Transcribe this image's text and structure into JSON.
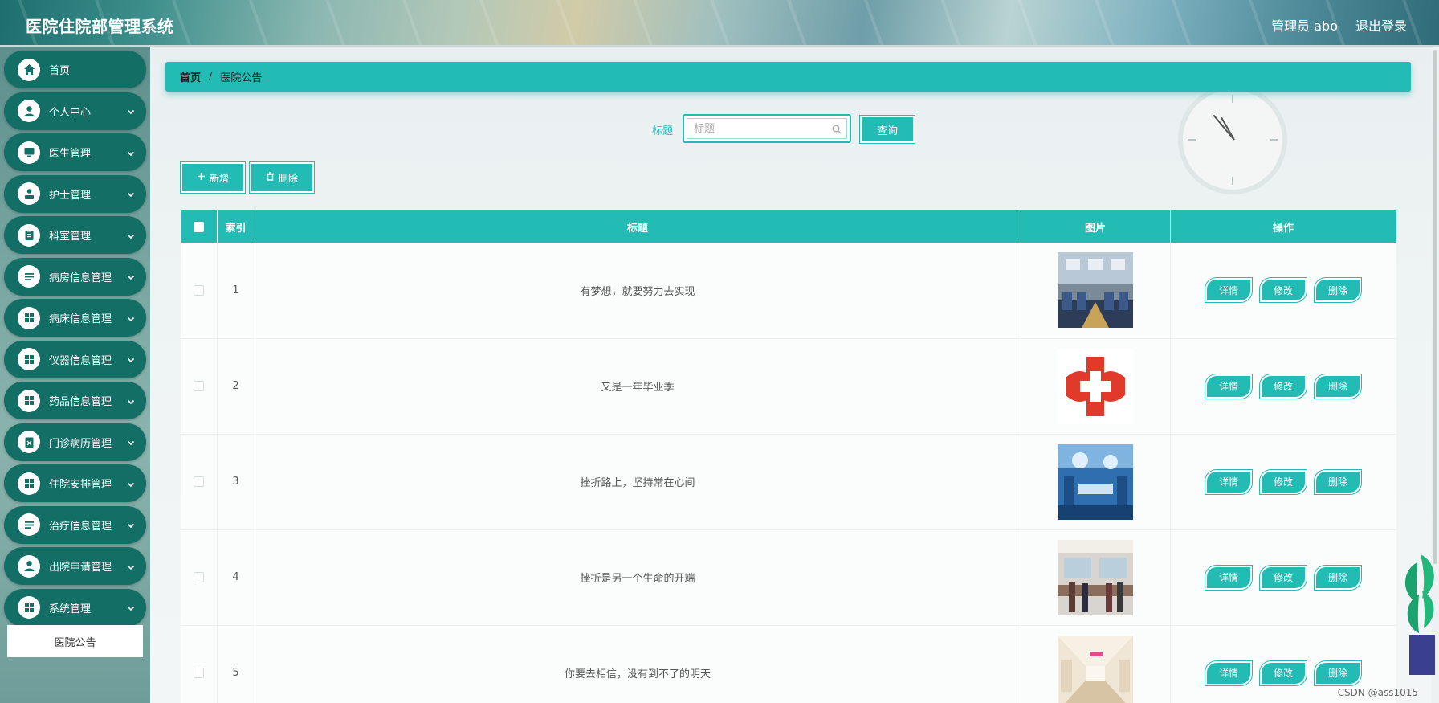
{
  "header": {
    "app_title": "医院住院部管理系统",
    "user_label": "管理员 abo",
    "logout_label": "退出登录"
  },
  "sidebar": {
    "items": [
      {
        "label": "首页",
        "icon": "home-icon"
      },
      {
        "label": "个人中心",
        "icon": "user-icon"
      },
      {
        "label": "医生管理",
        "icon": "monitor-icon"
      },
      {
        "label": "护士管理",
        "icon": "nurse-icon"
      },
      {
        "label": "科室管理",
        "icon": "clipboard-icon"
      },
      {
        "label": "病房信息管理",
        "icon": "list-icon"
      },
      {
        "label": "病床信息管理",
        "icon": "grid-icon"
      },
      {
        "label": "仪器信息管理",
        "icon": "grid-icon"
      },
      {
        "label": "药品信息管理",
        "icon": "grid-icon"
      },
      {
        "label": "门诊病历管理",
        "icon": "record-icon"
      },
      {
        "label": "住院安排管理",
        "icon": "grid-icon"
      },
      {
        "label": "治疗信息管理",
        "icon": "list-icon"
      },
      {
        "label": "出院申请管理",
        "icon": "user-icon"
      },
      {
        "label": "系统管理",
        "icon": "grid-icon"
      }
    ],
    "active_sub_item": "医院公告"
  },
  "breadcrumb": {
    "home": "首页",
    "separator": "/",
    "current": "医院公告"
  },
  "search": {
    "label": "标题",
    "placeholder": "标题",
    "value": "",
    "button_label": "查询"
  },
  "actions": {
    "add_label": "新增",
    "delete_label": "删除"
  },
  "table": {
    "columns": [
      "",
      "索引",
      "标题",
      "图片",
      "操作"
    ],
    "rows": [
      {
        "index": "1",
        "title": "有梦想，就要努力去实现",
        "image": "hospital-hall-image"
      },
      {
        "index": "2",
        "title": "又是一年毕业季",
        "image": "red-cross-logo-image"
      },
      {
        "index": "3",
        "title": "挫折路上，坚持常在心间",
        "image": "operating-room-image"
      },
      {
        "index": "4",
        "title": "挫折是另一个生命的开端",
        "image": "reception-desk-image"
      },
      {
        "index": "5",
        "title": "你要去相信，没有到不了的明天",
        "image": "corridor-image"
      }
    ],
    "row_actions": {
      "detail": "详情",
      "edit": "修改",
      "delete": "删除"
    }
  },
  "watermark": "CSDN @ass1015",
  "colors": {
    "accent": "#22bcb4",
    "sidebar_item": "#136e66",
    "header_text": "#ffffff"
  }
}
